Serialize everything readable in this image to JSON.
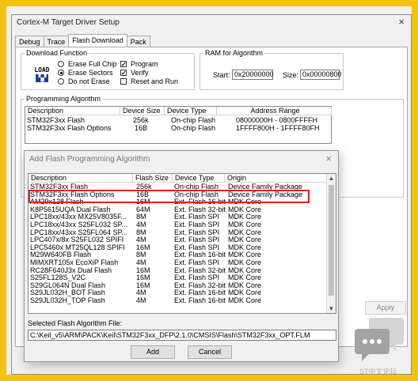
{
  "window": {
    "title": "Cortex-M Target Driver Setup",
    "close": "×"
  },
  "tabs": [
    "Debug",
    "Trace",
    "Flash Download",
    "Pack"
  ],
  "download": {
    "legend": "Download Function",
    "icon_text1": "LOAD",
    "options": [
      "Erase Full Chip",
      "Erase Sectors",
      "Do not Erase"
    ],
    "checks": [
      "Program",
      "Verify",
      "Reset and Run"
    ]
  },
  "ram": {
    "legend": "RAM for Algorithm",
    "start_label": "Start:",
    "start_value": "0x20000000",
    "size_label": "Size:",
    "size_value": "0x00000800"
  },
  "prog": {
    "legend": "Programming Algorithm",
    "headers": [
      "Description",
      "Device Size",
      "Device Type",
      "Address Range"
    ],
    "rows": [
      [
        "STM32F3xx Flash",
        "256k",
        "On-chip Flash",
        "08000000H - 0800FFFFH"
      ],
      [
        "STM32F3xx Flash Options",
        "16B",
        "On-chip Flash",
        "1FFFF800H - 1FFFF80FH"
      ]
    ]
  },
  "apply_label": "Apply",
  "dialog": {
    "title": "Add Flash Programming Algorithm",
    "close": "×",
    "headers": [
      "Description",
      "Flash Size",
      "Device Type",
      "Origin"
    ],
    "rows": [
      [
        "STM32F3xx Flash",
        "256k",
        "On-chip Flash",
        "Device Family Package"
      ],
      [
        "STM32F3xx Flash Options",
        "16B",
        "On-chip Flash",
        "Device Family Package"
      ],
      [
        "AM29x128 Flash",
        "16M",
        "Ext. Flash 16-bit",
        "MDK Core"
      ],
      [
        "K8P5615UQA Dual Flash",
        "64M",
        "Ext. Flash 32-bit",
        "MDK Core"
      ],
      [
        "LPC18xx/43xx MX25V8035F...",
        "8M",
        "Ext. Flash SPI",
        "MDK Core"
      ],
      [
        "LPC18xx/43xx S25FL032 SP...",
        "4M",
        "Ext. Flash SPI",
        "MDK Core"
      ],
      [
        "LPC18xx/43xx S25FL064 SP...",
        "8M",
        "Ext. Flash SPI",
        "MDK Core"
      ],
      [
        "LPC407x/8x S25FL032 SPIFI",
        "4M",
        "Ext. Flash SPI",
        "MDK Core"
      ],
      [
        "LPC5460x MT25QL128 SPIFI",
        "16M",
        "Ext. Flash SPI",
        "MDK Core"
      ],
      [
        "M29W640FB Flash",
        "8M",
        "Ext. Flash 16-bit",
        "MDK Core"
      ],
      [
        "MIMXRT105x EcoXiP Flash",
        "4M",
        "Ext. Flash SPI",
        "MDK Core"
      ],
      [
        "RC28F640J3x Dual Flash",
        "16M",
        "Ext. Flash 32-bit",
        "MDK Core"
      ],
      [
        "S25FL128S_V2C",
        "16M",
        "Ext. Flash SPI",
        "MDK Core"
      ],
      [
        "S29GL064N Dual Flash",
        "16M",
        "Ext. Flash 32-bit",
        "MDK Core"
      ],
      [
        "S29JL032H_BOT Flash",
        "4M",
        "Ext. Flash 16-bit",
        "MDK Core"
      ],
      [
        "S29JL032H_TOP Flash",
        "4M",
        "Ext. Flash 16-bit",
        "MDK Core"
      ]
    ],
    "selected_label": "Selected Flash Algorithm File:",
    "file_path": "C:\\Keil_v5\\ARM\\PACK\\Keil\\STM32F3xx_DFP\\2.1.0\\CMSIS\\Flash\\STM32F3xx_OPT.FLM",
    "add_label": "Add",
    "cancel_label": "Cancel"
  },
  "watermark": "ST中文论坛",
  "colors": {
    "frame": "#f3c20f",
    "highlight": "#e02020"
  }
}
